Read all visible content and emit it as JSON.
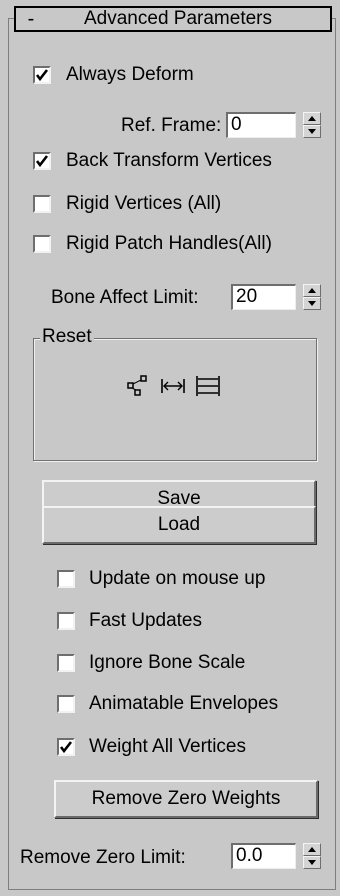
{
  "rollout": {
    "collapse_symbol": "-",
    "title": "Advanced Parameters"
  },
  "options": {
    "always_deform": {
      "label": "Always Deform",
      "checked": true
    },
    "back_transform": {
      "label": "Back Transform Vertices",
      "checked": true
    },
    "rigid_vertices": {
      "label": "Rigid Vertices (All)",
      "checked": false
    },
    "rigid_patch": {
      "label": "Rigid Patch Handles(All)",
      "checked": false
    }
  },
  "ref_frame": {
    "label": "Ref. Frame:",
    "value": "0"
  },
  "bone_affect_limit": {
    "label": "Bone Affect Limit:",
    "value": "20"
  },
  "reset": {
    "title": "Reset",
    "icons": [
      "reset-selected-vertices-icon",
      "reset-selected-bone-icon",
      "reset-all-bones-icon"
    ]
  },
  "buttons": {
    "save": "Save",
    "load": "Load",
    "remove_zero_weights": "Remove Zero Weights"
  },
  "toggles": {
    "update_mouse_up": {
      "label": "Update on mouse up",
      "checked": false
    },
    "fast_updates": {
      "label": "Fast Updates",
      "checked": false
    },
    "ignore_bone_scale": {
      "label": "Ignore Bone Scale",
      "checked": false
    },
    "animatable_envelopes": {
      "label": "Animatable Envelopes",
      "checked": false
    },
    "weight_all_vertices": {
      "label": "Weight All Vertices",
      "checked": true
    }
  },
  "remove_zero_limit": {
    "label": "Remove Zero Limit:",
    "value": "0.0"
  },
  "colors": {
    "panel_bg": "#c8c8c8",
    "field_bg": "#ffffff"
  }
}
